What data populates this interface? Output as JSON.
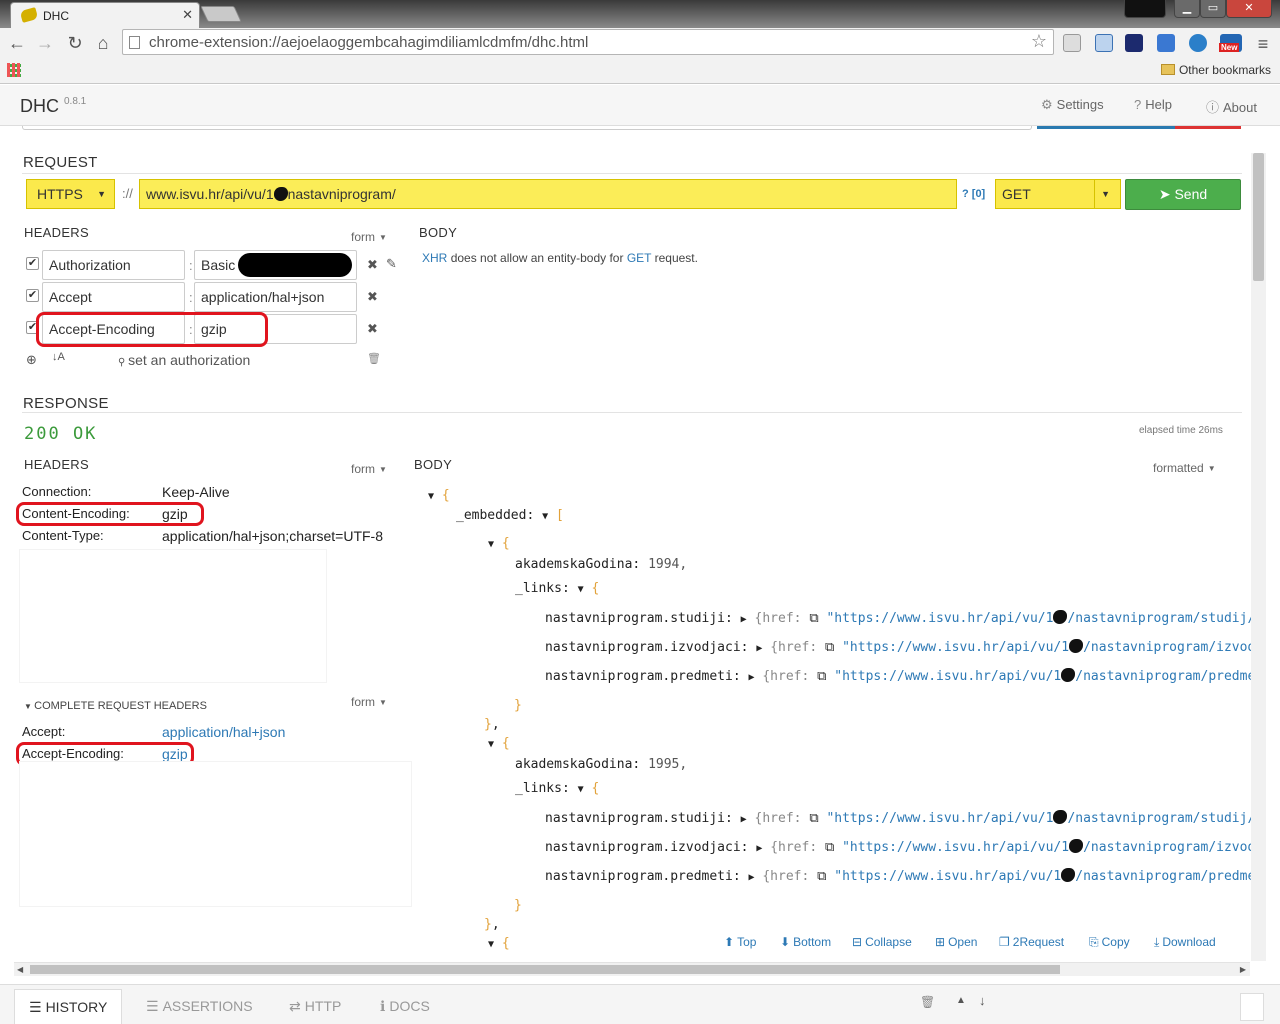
{
  "browser": {
    "tab_title": "DHC",
    "url": "chrome-extension://aejoelaoggembcahagimdiliamlcdmfm/dhc.html",
    "bookmarks_other": "Other bookmarks",
    "ext_new_badge": "New"
  },
  "app": {
    "title": "DHC",
    "version": "0.8.1",
    "nav": {
      "settings": "Settings",
      "help": "Help",
      "about": "About"
    }
  },
  "request": {
    "section_title": "REQUEST",
    "scheme": "HTTPS",
    "scheme_sep": "://",
    "url_prefix": "www.isvu.hr/api/vu/1",
    "url_suffix": "nastavniprogram/",
    "query_link": "? [0]",
    "method": "GET",
    "send_label": "Send",
    "headers_title": "HEADERS",
    "form_label": "form",
    "headers": [
      {
        "name": "Authorization",
        "value": "Basic"
      },
      {
        "name": "Accept",
        "value": "application/hal+json"
      },
      {
        "name": "Accept-Encoding",
        "value": "gzip"
      }
    ],
    "set_auth": "set an authorization",
    "body_title": "BODY",
    "body_msg": {
      "xhr": "XHR",
      "mid": "does not allow an entity-body for",
      "get": "GET",
      "end": "request."
    }
  },
  "response": {
    "section_title": "RESPONSE",
    "status": "200 OK",
    "elapsed": "elapsed time 26ms",
    "headers_title": "HEADERS",
    "form_label": "form",
    "headers": [
      {
        "key": "Connection:",
        "value": "Keep-Alive"
      },
      {
        "key": "Content-Encoding:",
        "value": "gzip"
      },
      {
        "key": "Content-Type:",
        "value": "application/hal+json;charset=UTF-8"
      }
    ],
    "complete_req_title": "COMPLETE REQUEST HEADERS",
    "complete_req_form": "form",
    "complete_headers": [
      {
        "key": "Accept:",
        "value": "application/hal+json"
      },
      {
        "key": "Accept-Encoding:",
        "value": "gzip"
      }
    ],
    "body_title": "BODY",
    "body_format": "formatted",
    "json": {
      "embedded_key": "_embedded:",
      "items": [
        {
          "ag_key": "akademskaGodina:",
          "ag_val": "1994,",
          "links_key": "_links:",
          "links": [
            {
              "k": "nastavniprogram.studiji:",
              "href": "{href:",
              "pre": "\"https://www.isvu.hr/api/vu/1",
              "post": "/nastavniprogram/studij/"
            },
            {
              "k": "nastavniprogram.izvodjaci:",
              "href": "{href:",
              "pre": "\"https://www.isvu.hr/api/vu/1",
              "post": "/nastavniprogram/izvod"
            },
            {
              "k": "nastavniprogram.predmeti:",
              "href": "{href:",
              "pre": "\"https://www.isvu.hr/api/vu/1",
              "post": "/nastavniprogram/predme"
            }
          ]
        },
        {
          "ag_key": "akademskaGodina:",
          "ag_val": "1995,",
          "links_key": "_links:",
          "links": [
            {
              "k": "nastavniprogram.studiji:",
              "href": "{href:",
              "pre": "\"https://www.isvu.hr/api/vu/1",
              "post": "/nastavniprogram/studij/"
            },
            {
              "k": "nastavniprogram.izvodjaci:",
              "href": "{href:",
              "pre": "\"https://www.isvu.hr/api/vu/1",
              "post": "/nastavniprogram/izvod"
            },
            {
              "k": "nastavniprogram.predmeti:",
              "href": "{href:",
              "pre": "\"https://www.isvu.hr/api/vu/1",
              "post": "/nastavniprogram/predme"
            }
          ]
        }
      ]
    },
    "actions": [
      "Top",
      "Bottom",
      "Collapse",
      "Open",
      "2Request",
      "Copy",
      "Download"
    ]
  },
  "bottom_tabs": [
    "HISTORY",
    "ASSERTIONS",
    "HTTP",
    "DOCS"
  ]
}
